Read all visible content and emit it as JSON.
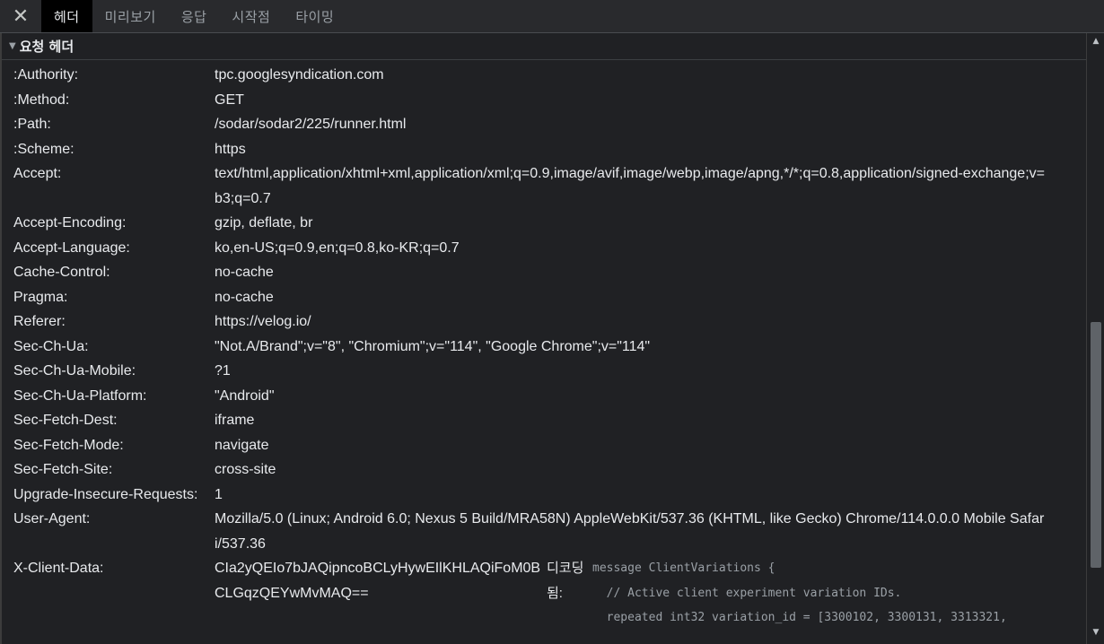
{
  "tabbar": {
    "close_glyph": "✕",
    "tabs": [
      {
        "label": "헤더"
      },
      {
        "label": "미리보기"
      },
      {
        "label": "응답"
      },
      {
        "label": "시작점"
      },
      {
        "label": "타이밍"
      }
    ]
  },
  "section": {
    "title": "요청 헤더"
  },
  "headers": [
    {
      "name": ":Authority:",
      "value": "tpc.googlesyndication.com"
    },
    {
      "name": ":Method:",
      "value": "GET"
    },
    {
      "name": ":Path:",
      "value": "/sodar/sodar2/225/runner.html"
    },
    {
      "name": ":Scheme:",
      "value": "https"
    },
    {
      "name": "Accept:",
      "value": "text/html,application/xhtml+xml,application/xml;q=0.9,image/avif,image/webp,image/apng,*/*;q=0.8,application/signed-exchange;v=b3;q=0.7"
    },
    {
      "name": "Accept-Encoding:",
      "value": "gzip, deflate, br"
    },
    {
      "name": "Accept-Language:",
      "value": "ko,en-US;q=0.9,en;q=0.8,ko-KR;q=0.7"
    },
    {
      "name": "Cache-Control:",
      "value": "no-cache"
    },
    {
      "name": "Pragma:",
      "value": "no-cache"
    },
    {
      "name": "Referer:",
      "value": "https://velog.io/"
    },
    {
      "name": "Sec-Ch-Ua:",
      "value": "\"Not.A/Brand\";v=\"8\", \"Chromium\";v=\"114\", \"Google Chrome\";v=\"114\""
    },
    {
      "name": "Sec-Ch-Ua-Mobile:",
      "value": "?1"
    },
    {
      "name": "Sec-Ch-Ua-Platform:",
      "value": "\"Android\""
    },
    {
      "name": "Sec-Fetch-Dest:",
      "value": "iframe"
    },
    {
      "name": "Sec-Fetch-Mode:",
      "value": "navigate"
    },
    {
      "name": "Sec-Fetch-Site:",
      "value": "cross-site"
    },
    {
      "name": "Upgrade-Insecure-Requests:",
      "value": "1"
    },
    {
      "name": "User-Agent:",
      "value": "Mozilla/5.0 (Linux; Android 6.0; Nexus 5 Build/MRA58N) AppleWebKit/537.36 (KHTML, like Gecko) Chrome/114.0.0.0 Mobile Safari/537.36"
    }
  ],
  "client_data": {
    "name": "X-Client-Data:",
    "value": "CIa2yQEIo7bJAQipncoBCLyHywEIlKHLAQiFoM0BCLGqzQEYwMvMAQ==",
    "decode_label": "디코딩됨:",
    "decoded": "message ClientVariations {\n  // Active client experiment variation IDs.\n  repeated int32 variation_id = [3300102, 3300131, 3313321,"
  }
}
